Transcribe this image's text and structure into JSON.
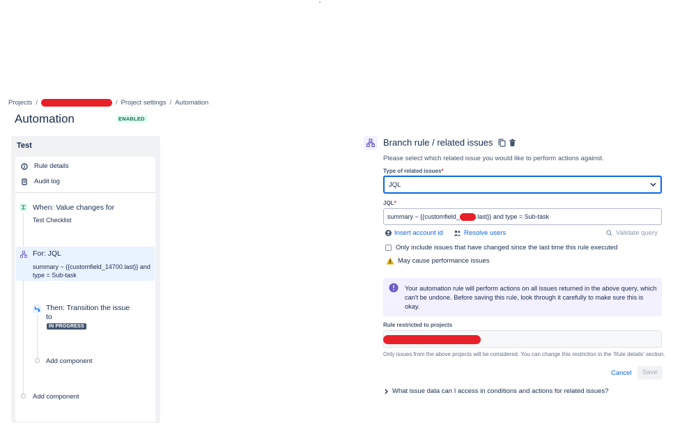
{
  "breadcrumb": {
    "projects": "Projects",
    "project_settings": "Project settings",
    "automation": "Automation"
  },
  "page": {
    "title": "Automation",
    "status": "ENABLED"
  },
  "rule": {
    "name": "Test",
    "menu": {
      "rule_details": "Rule details",
      "audit_log": "Audit log"
    },
    "trigger": {
      "title": "When: Value changes for",
      "subtitle": "Test Checklist"
    },
    "branch": {
      "title": "For: JQL",
      "line1": "summary ~ {{customfield_14700.last}} and",
      "line2": "type = Sub-task"
    },
    "action": {
      "title_line1": "Then: Transition the issue",
      "title_line2": "to",
      "status_badge": "IN PROGRESS"
    },
    "add_component_inner": "Add component",
    "add_component_outer": "Add component"
  },
  "branch_panel": {
    "title": "Branch rule / related issues",
    "description": "Please select which related issue you would like to perform actions against.",
    "type_label": "Type of related issues",
    "type_value": "JQL",
    "jql_label": "JQL",
    "jql_prefix": "summary ~ {{customfield_",
    "jql_suffix": ".last}} and type = Sub-task",
    "insert_account_id": "Insert account id",
    "resolve_users": "Resolve users",
    "validate_query": "Validate query",
    "checkbox_label": "Only include issues that have changed since the last time this rule executed",
    "warning": "May cause performance issues",
    "info": "Your automation rule will perform actions on all issues returned in the above query, which can't be undone. Before saving this rule, look through it carefully to make sure this is okay.",
    "restricted_label": "Rule restricted to projects",
    "helper": "Only issues from the above projects will be considered. You can change this restriction in the 'Rule details' section.",
    "cancel": "Cancel",
    "save": "Save",
    "expander": "What issue data can I access in conditions and actions for related issues?"
  },
  "colors": {
    "primary": "#0c66e4",
    "redaction": "#e8202a",
    "enabled_bg": "#dcfff1",
    "enabled_text": "#216e4e",
    "info_bg": "#f3f0ff",
    "selected_bg": "#e9f2ff"
  },
  "icons": [
    "info-circle-icon",
    "document-icon",
    "trigger-icon",
    "branch-icon",
    "transition-icon",
    "copy-icon",
    "trash-icon",
    "chevron-down-icon",
    "user-circle-icon",
    "users-icon",
    "search-icon",
    "warning-icon",
    "chevron-right-icon"
  ]
}
